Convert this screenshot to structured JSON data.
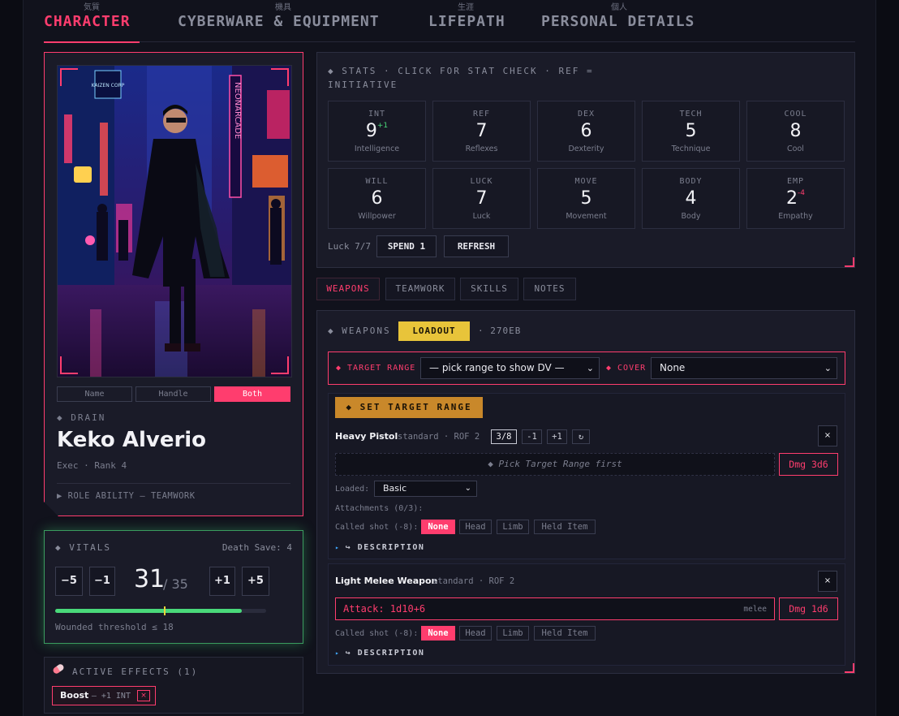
{
  "top_tabs": [
    {
      "kanji": "気質",
      "label": "CHARACTER",
      "active": true
    },
    {
      "kanji": "機具",
      "label": "CYBERWARE & EQUIPMENT"
    },
    {
      "kanji": "生涯",
      "label": "LIFEPATH"
    },
    {
      "kanji": "個人",
      "label": "PERSONAL DETAILS"
    }
  ],
  "character": {
    "portrait_signs": [
      "KAIZEN CORP",
      "NEONARCADE"
    ],
    "name_modes": [
      "Name",
      "Handle",
      "Both"
    ],
    "name_mode_selected": "Both",
    "handle": "◆ DRAIN",
    "name": "Keko Alverio",
    "role_line": "Exec · Rank 4",
    "role_ability": "▶ ROLE ABILITY — TEAMWORK"
  },
  "vitals": {
    "title": "◆ VITALS",
    "death_save": "Death Save: 4",
    "buttons": [
      "−5",
      "−1",
      "+1",
      "+5"
    ],
    "hp_current": "31",
    "hp_max": "/ 35",
    "hp_current_value": 31,
    "hp_max_value": 35,
    "wounded_value": 18,
    "wounded": "Wounded threshold ≤ 18",
    "bar_color": "#49d97a"
  },
  "effects": {
    "title": "ACTIVE EFFECTS (1)",
    "items": [
      {
        "name": "Boost",
        "detail": "— +1 INT",
        "remove": "×"
      }
    ]
  },
  "stats": {
    "title": "◆ STATS · CLICK FOR STAT CHECK · REF = INITIATIVE",
    "cells": [
      {
        "abbr": "INT",
        "value": "9",
        "mod": "+1",
        "mod_color": "#49d97a",
        "name": "Intelligence"
      },
      {
        "abbr": "REF",
        "value": "7",
        "mod": "",
        "name": "Reflexes"
      },
      {
        "abbr": "DEX",
        "value": "6",
        "mod": "",
        "name": "Dexterity"
      },
      {
        "abbr": "TECH",
        "value": "5",
        "mod": "",
        "name": "Technique"
      },
      {
        "abbr": "COOL",
        "value": "8",
        "mod": "",
        "name": "Cool"
      },
      {
        "abbr": "WILL",
        "value": "6",
        "mod": "",
        "name": "Willpower"
      },
      {
        "abbr": "LUCK",
        "value": "7",
        "mod": "",
        "name": "Luck"
      },
      {
        "abbr": "MOVE",
        "value": "5",
        "mod": "",
        "name": "Movement"
      },
      {
        "abbr": "BODY",
        "value": "4",
        "mod": "",
        "name": "Body"
      },
      {
        "abbr": "EMP",
        "value": "2",
        "mod": "-4",
        "mod_color": "#ff3d6e",
        "name": "Empathy"
      }
    ],
    "luck": "Luck 7/7",
    "spend": "SPEND 1",
    "refresh": "REFRESH"
  },
  "sub_tabs": [
    "WEAPONS",
    "TEAMWORK",
    "SKILLS",
    "NOTES"
  ],
  "weapons": {
    "title": "◆ WEAPONS",
    "loadout": "LOADOUT",
    "eb": "· 270EB",
    "target_label": "◆ TARGET RANGE",
    "target_value": "— pick range to show DV —",
    "cover_label": "◆ COVER",
    "cover_value": "None",
    "set_target": "◆ SET TARGET RANGE",
    "items": [
      {
        "name": "Heavy Pistol",
        "meta": "standard · ROF 2",
        "ammo": "3/8",
        "ammo_minus": "-1",
        "ammo_plus": "+1",
        "reload": "↻",
        "remove": "×",
        "pick": "◆ Pick Target Range first",
        "dmg": "Dmg 3d6",
        "loaded_label": "Loaded:",
        "loaded_value": "Basic",
        "attachments": "Attachments (0/3):",
        "called_label": "Called shot (-8):",
        "called": [
          "None",
          "Head",
          "Limb",
          "Held Item"
        ],
        "desc": "↪ DESCRIPTION"
      },
      {
        "name": "Light Melee Weapon",
        "meta": "standard · ROF 2",
        "remove": "×",
        "attack": "Attack: 1d10+6",
        "melee": "melee",
        "dmg": "Dmg 1d6",
        "called_label": "Called shot (-8):",
        "called": [
          "None",
          "Head",
          "Limb",
          "Held Item"
        ],
        "desc": "↪ DESCRIPTION"
      }
    ]
  },
  "colors": {
    "accent": "#ff3d6e",
    "gold": "#e8c43a",
    "green": "#49d97a"
  }
}
